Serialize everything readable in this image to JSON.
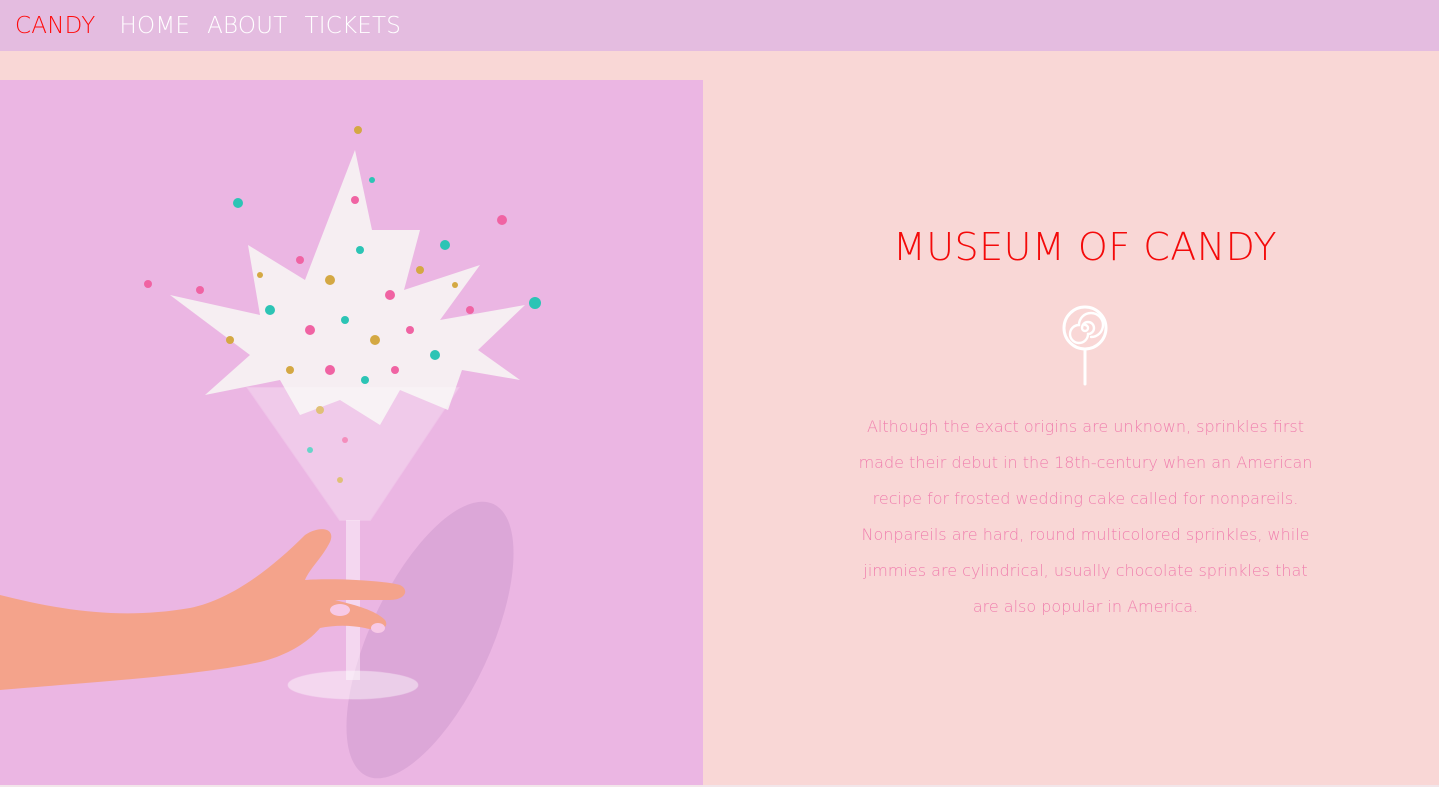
{
  "nav": {
    "brand": "CANDY",
    "links": [
      "HOME",
      "ABOUT",
      "TICKETS"
    ]
  },
  "hero": {
    "title": "MUSEUM OF CANDY",
    "body": "Although the exact origins are unknown, sprinkles first made their debut in the 18th-century when an American recipe for frosted wedding cake called for nonpareils. Nonpareils are hard, round multicolored sprinkles, while jimmies are cylindrical, usually chocolate sprinkles that are also popular in America.",
    "icon": "lollipop-icon"
  },
  "colors": {
    "nav_bg": "#e4bce0",
    "page_bg": "#f9d7d6",
    "image_bg": "#ebb6e3",
    "accent_red": "#f40a0a",
    "text_pink": "#f07fae"
  }
}
